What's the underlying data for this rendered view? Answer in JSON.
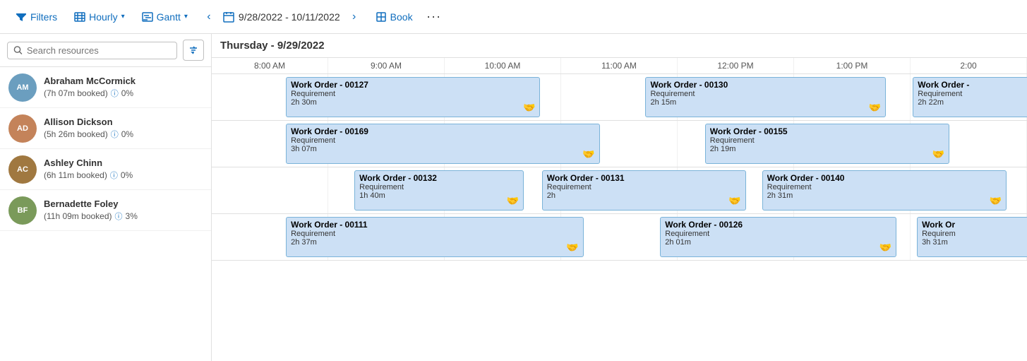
{
  "toolbar": {
    "filters_label": "Filters",
    "hourly_label": "Hourly",
    "gantt_label": "Gantt",
    "date_range": "9/28/2022 - 10/11/2022",
    "book_label": "Book",
    "more_label": "···"
  },
  "schedule": {
    "date_header": "Thursday - 9/29/2022",
    "time_slots": [
      "8:00 AM",
      "9:00 AM",
      "10:00 AM",
      "11:00 AM",
      "12:00 PM",
      "1:00 PM",
      "2:00"
    ],
    "search_placeholder": "Search resources"
  },
  "resources": [
    {
      "id": "abraham",
      "name": "Abraham McCormick",
      "meta": "(7h 07m booked)",
      "utilization": "0%",
      "avatar_color": "#6b9ebf",
      "avatar_text": "AM"
    },
    {
      "id": "allison",
      "name": "Allison Dickson",
      "meta": "(5h 26m booked)",
      "utilization": "0%",
      "avatar_color": "#c4835a",
      "avatar_text": "AD"
    },
    {
      "id": "ashley",
      "name": "Ashley Chinn",
      "meta": "(6h 11m booked)",
      "utilization": "0%",
      "avatar_color": "#a07840",
      "avatar_text": "AC"
    },
    {
      "id": "bernadette",
      "name": "Bernadette Foley",
      "meta": "(11h 09m booked)",
      "utilization": "3%",
      "avatar_color": "#7a9a5a",
      "avatar_text": "BF"
    }
  ],
  "work_orders": {
    "abraham": [
      {
        "id": "wo127",
        "title": "Work Order - 00127",
        "sub": "Requirement",
        "duration": "2h 30m",
        "left_pct": 9.1,
        "width_pct": 31.2
      },
      {
        "id": "wo130",
        "title": "Work Order - 00130",
        "sub": "Requirement",
        "duration": "2h 15m",
        "left_pct": 53.2,
        "width_pct": 29.5
      },
      {
        "id": "wo_cut1",
        "title": "Work Order -",
        "sub": "Requirement",
        "duration": "2h 22m",
        "left_pct": 86.0,
        "width_pct": 20.0
      }
    ],
    "allison": [
      {
        "id": "wo169",
        "title": "Work Order - 00169",
        "sub": "Requirement",
        "duration": "3h 07m",
        "left_pct": 9.1,
        "width_pct": 38.5
      },
      {
        "id": "wo155",
        "title": "Work Order - 00155",
        "sub": "Requirement",
        "duration": "2h 19m",
        "left_pct": 60.5,
        "width_pct": 30.0
      }
    ],
    "ashley": [
      {
        "id": "wo132",
        "title": "Work Order - 00132",
        "sub": "Requirement",
        "duration": "1h 40m",
        "left_pct": 17.5,
        "width_pct": 20.8
      },
      {
        "id": "wo131",
        "title": "Work Order - 00131",
        "sub": "Requirement",
        "duration": "2h",
        "left_pct": 40.5,
        "width_pct": 25.0
      },
      {
        "id": "wo140",
        "title": "Work Order - 00140",
        "sub": "Requirement",
        "duration": "2h 31m",
        "left_pct": 67.5,
        "width_pct": 30.0
      }
    ],
    "bernadette": [
      {
        "id": "wo111",
        "title": "Work Order - 00111",
        "sub": "Requirement",
        "duration": "2h 37m",
        "left_pct": 9.1,
        "width_pct": 36.5
      },
      {
        "id": "wo126",
        "title": "Work Order - 00126",
        "sub": "Requirement",
        "duration": "2h 01m",
        "left_pct": 55.0,
        "width_pct": 29.0
      },
      {
        "id": "wo_cut2",
        "title": "Work Or",
        "sub": "Requirem",
        "duration": "3h 31m",
        "left_pct": 86.5,
        "width_pct": 20.0
      }
    ]
  },
  "icons": {
    "filter": "▼",
    "sort": "⇅",
    "calendar": "📅",
    "handshake": "🤝",
    "clock": "⏱",
    "info": "ⓘ"
  }
}
